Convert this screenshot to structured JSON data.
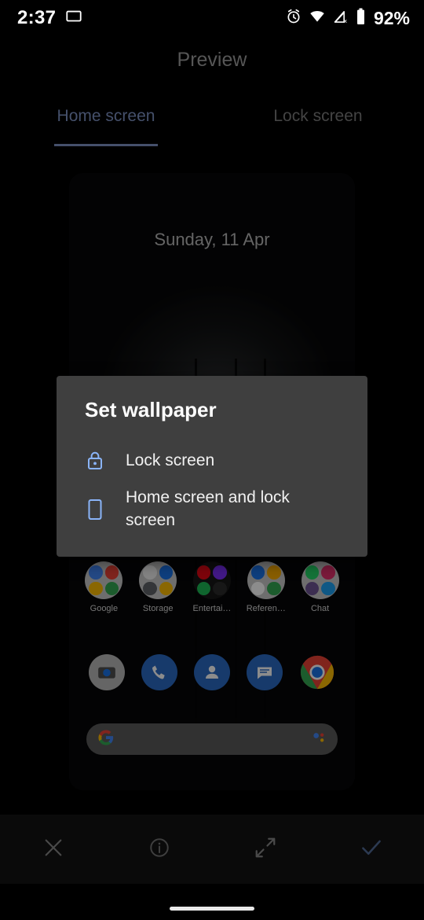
{
  "status_bar": {
    "time": "2:37",
    "battery_percent": "92%",
    "icons": [
      "cast-screen-icon",
      "alarm-icon",
      "wifi-icon",
      "no-sim-signal-icon",
      "battery-icon"
    ]
  },
  "header": {
    "title": "Preview",
    "tabs": [
      {
        "label": "Home screen",
        "active": true
      },
      {
        "label": "Lock screen",
        "active": false
      }
    ]
  },
  "preview": {
    "date_widget": "Sunday, 11 Apr",
    "folders": [
      {
        "label": "Google",
        "colors": [
          "#4285f4",
          "#ea4335",
          "#fbbc05",
          "#34a853"
        ],
        "dark": false
      },
      {
        "label": "Storage",
        "colors": [
          "#f1f1f1",
          "#1a73e8",
          "#5f6368",
          "#fbbc05"
        ],
        "dark": false
      },
      {
        "label": "Entertai…",
        "colors": [
          "#e50914",
          "#7b2ff7",
          "#1db954",
          "#222222"
        ],
        "dark": true
      },
      {
        "label": "Referen…",
        "colors": [
          "#1a73e8",
          "#f9ab00",
          "#ffffff",
          "#34a853"
        ],
        "dark": false
      },
      {
        "label": "Chat",
        "colors": [
          "#25d366",
          "#e1306c",
          "#6e5494",
          "#1da1f2"
        ],
        "dark": false
      }
    ],
    "dock": [
      {
        "name": "camera-app-icon",
        "style": "grey",
        "glyph": "◉"
      },
      {
        "name": "phone-app-icon",
        "style": "blue",
        "glyph": "✆"
      },
      {
        "name": "contacts-app-icon",
        "style": "blue",
        "glyph": "●"
      },
      {
        "name": "messages-app-icon",
        "style": "blue",
        "glyph": "▤"
      },
      {
        "name": "chrome-app-icon",
        "style": "chrome",
        "glyph": ""
      }
    ],
    "search_bar": {
      "left_icon": "google-g-icon",
      "right_icon": "google-assistant-icon",
      "value": "",
      "placeholder": ""
    }
  },
  "dialog": {
    "title": "Set wallpaper",
    "options": [
      {
        "label": "Lock screen",
        "icon": "lock-icon"
      },
      {
        "label": "Home screen and lock screen",
        "icon": "phone-icon"
      }
    ]
  },
  "bottom_bar": {
    "buttons": [
      {
        "name": "close-button",
        "icon": "close-icon"
      },
      {
        "name": "info-button",
        "icon": "info-icon"
      },
      {
        "name": "expand-button",
        "icon": "expand-icon"
      },
      {
        "name": "confirm-button",
        "icon": "check-icon"
      }
    ]
  },
  "colors": {
    "accent_blue": "#8ab4f8",
    "tab_active": "#7f93c4",
    "dialog_bg": "#3f3f3f",
    "background": "#000000"
  }
}
